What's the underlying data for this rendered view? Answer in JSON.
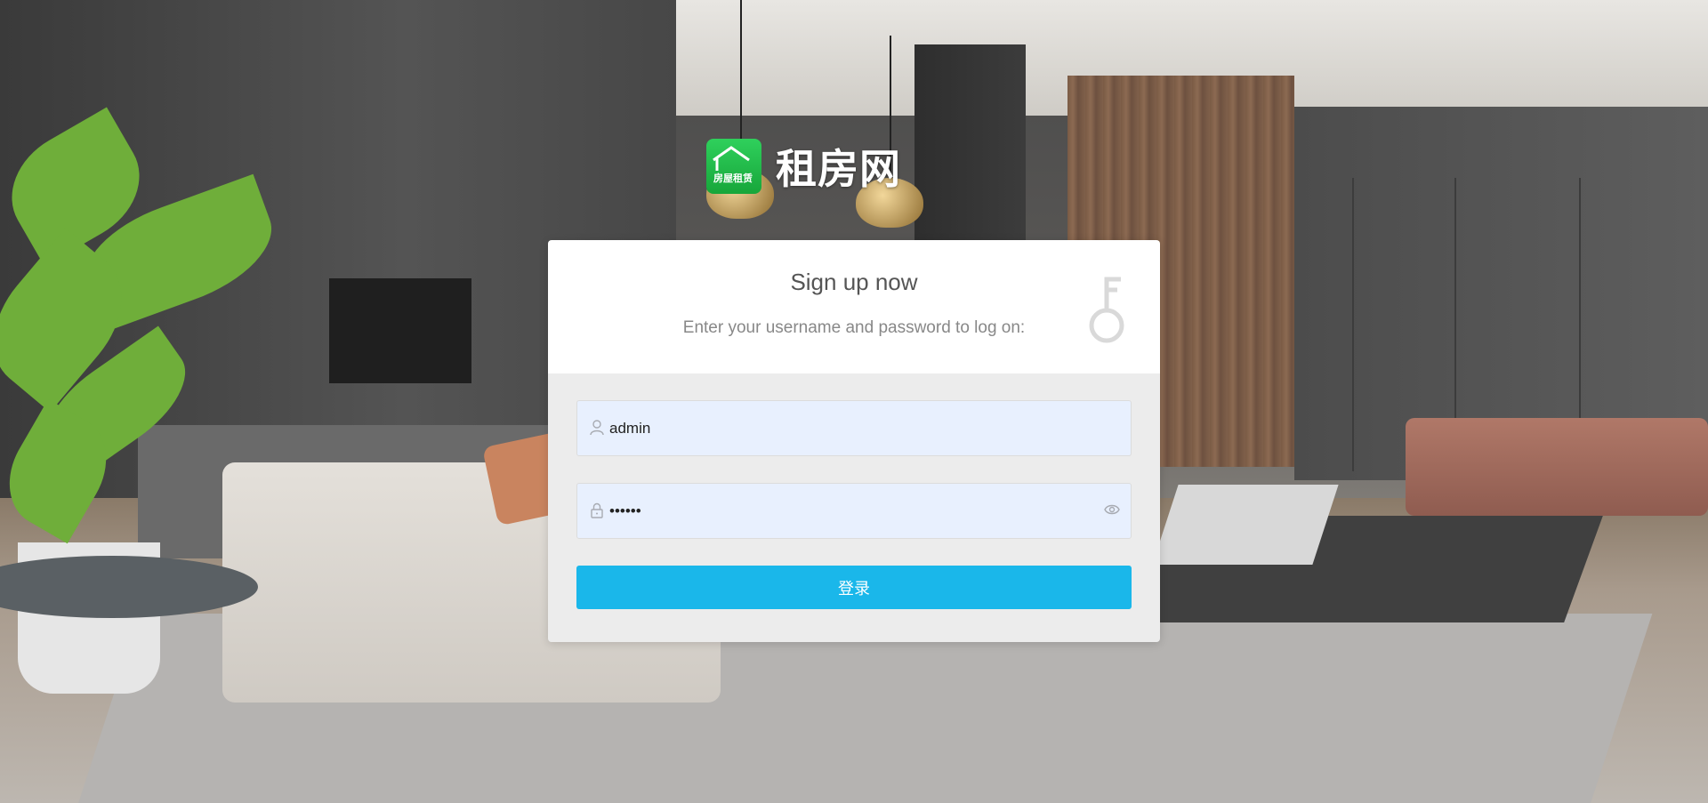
{
  "brand": {
    "name": "租房网",
    "logo_text": "房屋租赁",
    "logo_color": "#22c24a"
  },
  "login": {
    "title": "Sign up now",
    "subtitle": "Enter your username and password to log on:",
    "username": {
      "value": "admin",
      "icon": "user-icon"
    },
    "password": {
      "value": "••••••",
      "icon": "lock-icon",
      "toggle_icon": "eye-icon"
    },
    "submit_label": "登录",
    "submit_color": "#1ab7ea",
    "header_icon": "key-icon"
  }
}
